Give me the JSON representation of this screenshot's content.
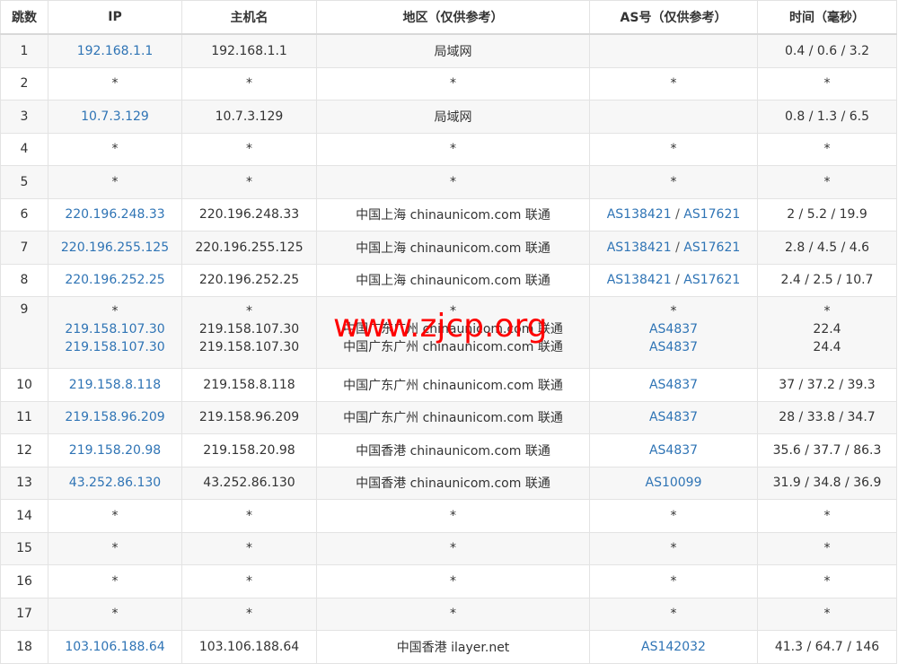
{
  "headers": [
    "跳数",
    "IP",
    "主机名",
    "地区（仅供参考）",
    "AS号（仅供参考）",
    "时间（毫秒）"
  ],
  "watermark": "www.zjcp.org",
  "rows": [
    {
      "hop": "1",
      "ip": "192.168.1.1",
      "host": "192.168.1.1",
      "region": "局域网",
      "as1": "",
      "as_sep": "",
      "as2": "",
      "time": "0.4 / 0.6 / 3.2"
    },
    {
      "hop": "2",
      "ip": "*",
      "host": "*",
      "region": "*",
      "as1": "*",
      "as_sep": "",
      "as2": "",
      "time": "*"
    },
    {
      "hop": "3",
      "ip": "10.7.3.129",
      "host": "10.7.3.129",
      "region": "局域网",
      "as1": "",
      "as_sep": "",
      "as2": "",
      "time": "0.8 / 1.3 / 6.5"
    },
    {
      "hop": "4",
      "ip": "*",
      "host": "*",
      "region": "*",
      "as1": "*",
      "as_sep": "",
      "as2": "",
      "time": "*"
    },
    {
      "hop": "5",
      "ip": "*",
      "host": "*",
      "region": "*",
      "as1": "*",
      "as_sep": "",
      "as2": "",
      "time": "*"
    },
    {
      "hop": "6",
      "ip": "220.196.248.33",
      "host": "220.196.248.33",
      "region": "中国上海 chinaunicom.com 联通",
      "as1": "AS138421",
      "as_sep": " / ",
      "as2": "AS17621",
      "time": "2 / 5.2 / 19.9"
    },
    {
      "hop": "7",
      "ip": "220.196.255.125",
      "host": "220.196.255.125",
      "region": "中国上海 chinaunicom.com 联通",
      "as1": "AS138421",
      "as_sep": " / ",
      "as2": "AS17621",
      "time": "2.8 / 4.5 / 4.6"
    },
    {
      "hop": "8",
      "ip": "220.196.252.25",
      "host": "220.196.252.25",
      "region": "中国上海 chinaunicom.com 联通",
      "as1": "AS138421",
      "as_sep": " / ",
      "as2": "AS17621",
      "time": "2.4 / 2.5 / 10.7"
    },
    {
      "hop": "9",
      "lines": [
        {
          "ip": "*",
          "host": "*",
          "region": "*",
          "as": "*",
          "time": "*"
        },
        {
          "ip": "219.158.107.30",
          "host": "219.158.107.30",
          "region": "中国广东广州 chinaunicom.com 联通",
          "as": "AS4837",
          "time": "22.4"
        },
        {
          "ip": "219.158.107.30",
          "host": "219.158.107.30",
          "region": "中国广东广州 chinaunicom.com 联通",
          "as": "AS4837",
          "time": "24.4"
        }
      ]
    },
    {
      "hop": "10",
      "ip": "219.158.8.118",
      "host": "219.158.8.118",
      "region": "中国广东广州 chinaunicom.com 联通",
      "as1": "AS4837",
      "as_sep": "",
      "as2": "",
      "time": "37 / 37.2 / 39.3"
    },
    {
      "hop": "11",
      "ip": "219.158.96.209",
      "host": "219.158.96.209",
      "region": "中国广东广州 chinaunicom.com 联通",
      "as1": "AS4837",
      "as_sep": "",
      "as2": "",
      "time": "28 / 33.8 / 34.7"
    },
    {
      "hop": "12",
      "ip": "219.158.20.98",
      "host": "219.158.20.98",
      "region": "中国香港 chinaunicom.com 联通",
      "as1": "AS4837",
      "as_sep": "",
      "as2": "",
      "time": "35.6 / 37.7 / 86.3"
    },
    {
      "hop": "13",
      "ip": "43.252.86.130",
      "host": "43.252.86.130",
      "region": "中国香港 chinaunicom.com 联通",
      "as1": "AS10099",
      "as_sep": "",
      "as2": "",
      "time": "31.9 / 34.8 / 36.9"
    },
    {
      "hop": "14",
      "ip": "*",
      "host": "*",
      "region": "*",
      "as1": "*",
      "as_sep": "",
      "as2": "",
      "time": "*"
    },
    {
      "hop": "15",
      "ip": "*",
      "host": "*",
      "region": "*",
      "as1": "*",
      "as_sep": "",
      "as2": "",
      "time": "*"
    },
    {
      "hop": "16",
      "ip": "*",
      "host": "*",
      "region": "*",
      "as1": "*",
      "as_sep": "",
      "as2": "",
      "time": "*"
    },
    {
      "hop": "17",
      "ip": "*",
      "host": "*",
      "region": "*",
      "as1": "*",
      "as_sep": "",
      "as2": "",
      "time": "*"
    },
    {
      "hop": "18",
      "ip": "103.106.188.64",
      "host": "103.106.188.64",
      "region": "中国香港 ilayer.net",
      "as1": "AS142032",
      "as_sep": "",
      "as2": "",
      "time": "41.3 / 64.7 / 146"
    }
  ]
}
